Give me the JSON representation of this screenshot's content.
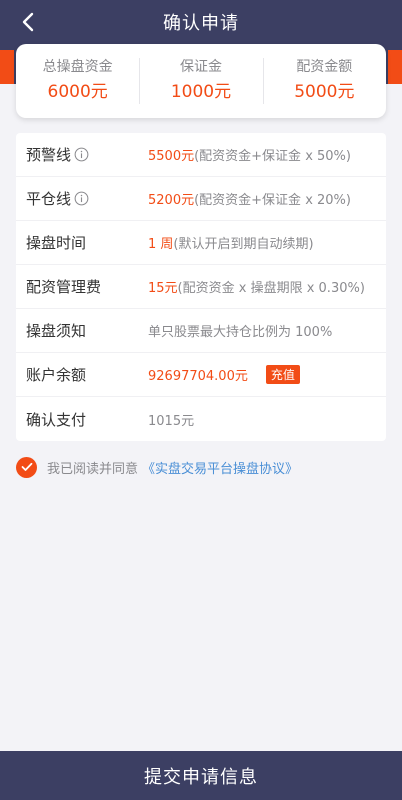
{
  "header": {
    "title": "确认申请"
  },
  "summary": [
    {
      "label": "总操盘资金",
      "value": "6000元"
    },
    {
      "label": "保证金",
      "value": "1000元"
    },
    {
      "label": "配资金额",
      "value": "5000元"
    }
  ],
  "rows": {
    "warning": {
      "label": "预警线",
      "highlight": "5500元",
      "note": "(配资资金+保证金 x 50%)"
    },
    "liquidation": {
      "label": "平仓线",
      "highlight": "5200元",
      "note": " (配资资金+保证金 x 20%)"
    },
    "duration": {
      "label": "操盘时间",
      "highlight": "1 周",
      "note": "(默认开启到期自动续期)"
    },
    "fee": {
      "label": "配资管理费",
      "highlight": "15元",
      "note": "(配资资金 x 操盘期限 x 0.30%)"
    },
    "notice": {
      "label": "操盘须知",
      "note": "单只股票最大持仓比例为 100%"
    },
    "balance": {
      "label": "账户余额",
      "highlight": "92697704.00元",
      "button": "充值"
    },
    "payment": {
      "label": "确认支付",
      "note": "1015元"
    }
  },
  "agreement": {
    "text": "我已阅读并同意",
    "link": "《实盘交易平台操盘协议》"
  },
  "footer": {
    "submit_label": "提交申请信息"
  },
  "colors": {
    "nav": "#3c3f63",
    "accent": "#f24c16",
    "link": "#4a8fd6"
  },
  "icons": {
    "back": "chevron-left-icon",
    "info": "info-icon",
    "check": "check-icon"
  }
}
